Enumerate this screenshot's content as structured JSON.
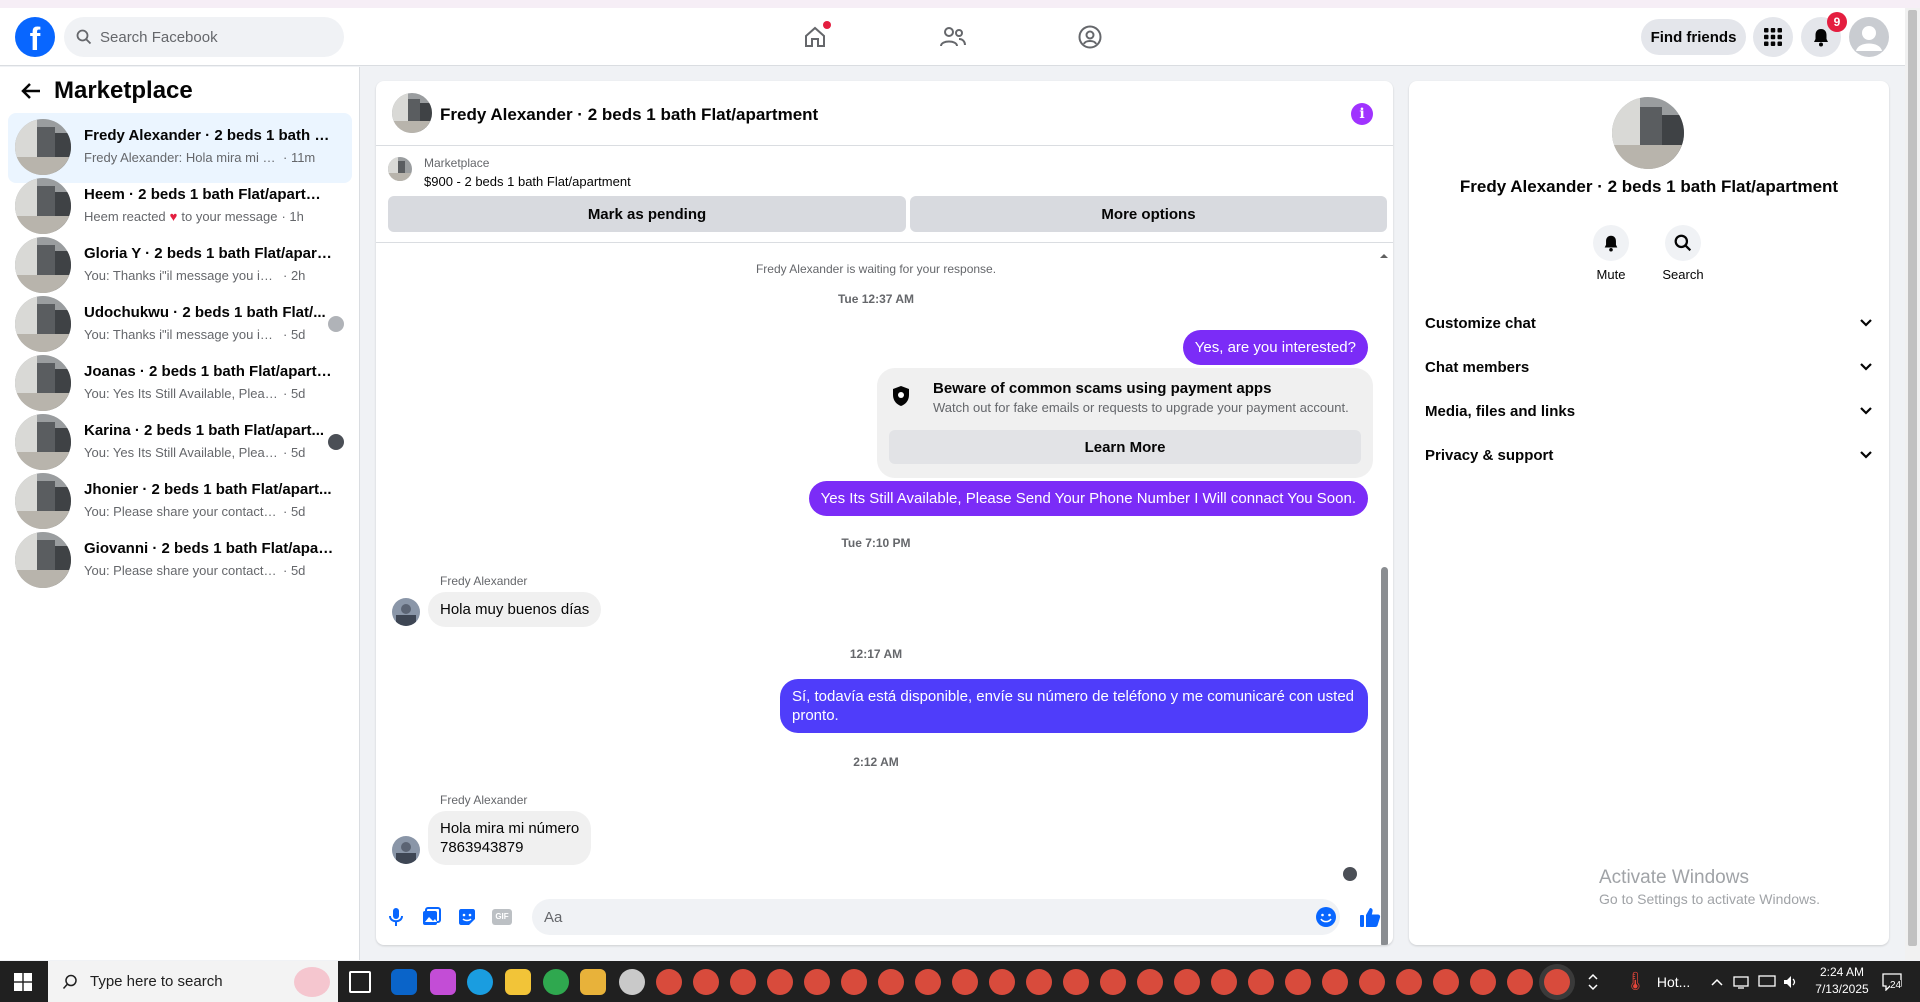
{
  "topnav": {
    "search_placeholder": "Search Facebook",
    "find_friends_label": "Find friends",
    "notifications_count": "9",
    "logo_letter": "f"
  },
  "sidebar": {
    "title": "Marketplace",
    "conversations": [
      {
        "name": "Fredy Alexander · 2 beds 1 bath Fla...",
        "preview": "Fredy Alexander: Hola mira mi núm...",
        "time": "· 11m"
      },
      {
        "name": "Heem · 2 beds 1 bath Flat/apartme...",
        "preview_before": "Heem reacted",
        "preview_after": "to your message",
        "time": "· 1h"
      },
      {
        "name": "Gloria Y · 2 beds 1 bath Flat/apart...",
        "preview": "You: Thanks i\"il message you in a mo...",
        "time": "· 2h"
      },
      {
        "name": "Udochukwu · 2 beds 1 bath Flat/...",
        "preview": "You: Thanks i\"il message you in a ...",
        "time": "· 5d"
      },
      {
        "name": "Joanas · 2 beds 1 bath Flat/apartm...",
        "preview": "You: Yes Its Still Available, Please Send...",
        "time": "· 5d"
      },
      {
        "name": "Karina · 2 beds 1 bath Flat/apart...",
        "preview": "You: Yes Its Still Available, Please Se...",
        "time": "· 5d"
      },
      {
        "name": "Jhonier · 2 beds 1 bath Flat/apart...",
        "preview": "You: Please share your contact numbe...",
        "time": "· 5d"
      },
      {
        "name": "Giovanni · 2 beds 1 bath Flat/apart...",
        "preview": "You: Please share your contact numbe...",
        "time": "· 5d"
      }
    ]
  },
  "chat": {
    "title": "Fredy Alexander · 2 beds 1 bath Flat/apartment",
    "info_glyph": "i",
    "marketplace_label": "Marketplace",
    "listing": "$900 - 2 beds 1 bath Flat/apartment",
    "mark_pending_label": "Mark as pending",
    "more_options_label": "More options",
    "waiting_note": "Fredy Alexander is waiting for your response.",
    "ts1": "Tue 12:37 AM",
    "msg1": "Yes, are you interested?",
    "scam_title": "Beware of common scams using payment apps",
    "scam_desc": "Watch out for fake emails or requests to upgrade your payment account.",
    "learn_more": "Learn More",
    "msg2": "Yes Its Still Available, Please Send Your Phone Number I Will connact You Soon.",
    "ts2": "Tue 7:10 PM",
    "sender1": "Fredy Alexander",
    "msg3": "Hola muy buenos días",
    "ts3": "12:17 AM",
    "msg4_line1": "Sí, todavía está disponible, envíe su número de teléfono y me comunicaré con usted",
    "msg4_line2": "pronto.",
    "ts4": "2:12 AM",
    "sender2": "Fredy Alexander",
    "msg5_line1": "Hola mira mi número",
    "msg5_line2": "7863943879",
    "composer_placeholder": "Aa",
    "composer_icons": [
      "microphone-icon",
      "photo-icon",
      "sticker-icon",
      "gif-icon",
      "emoji-icon",
      "thumbs-up-icon"
    ],
    "gif_label": "GIF"
  },
  "right_panel": {
    "name": "Fredy Alexander · 2 beds 1 bath Flat/apartment",
    "mute_label": "Mute",
    "search_label": "Search",
    "rows": [
      "Customize chat",
      "Chat members",
      "Media, files and links",
      "Privacy & support"
    ]
  },
  "watermark": {
    "line1": "Activate Windows",
    "line2": "Go to Settings to activate Windows."
  },
  "taskbar": {
    "search_placeholder": "Type here to search",
    "weather": "Hot...",
    "time": "2:24 AM",
    "date": "7/13/2025",
    "notif_count": "24"
  },
  "colors": {
    "accent": "#0866ff",
    "outgoing_bubble": "#7b2cf7",
    "info_purple": "#a033ff",
    "badge_red": "#e41e3f"
  }
}
